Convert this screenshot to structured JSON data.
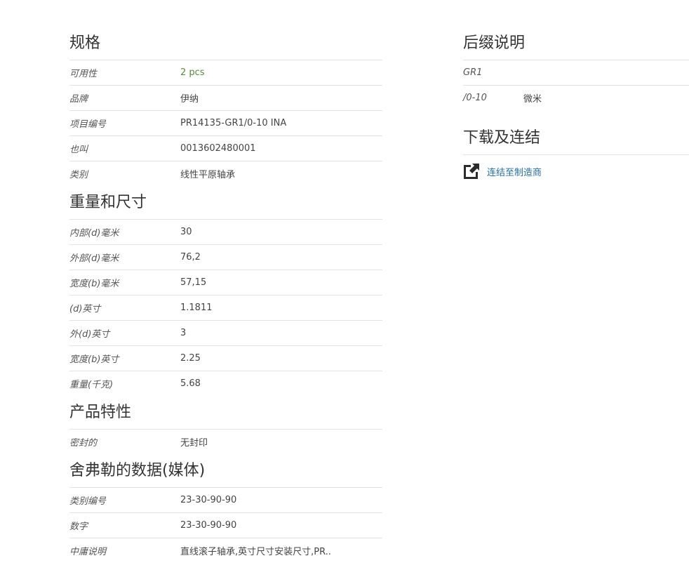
{
  "specs": {
    "title": "规格",
    "rows": [
      {
        "label": "可用性",
        "value": "2 pcs"
      },
      {
        "label": "品牌",
        "value": "伊纳"
      },
      {
        "label": "项目编号",
        "value": "PR14135-GR1/0-10 INA"
      },
      {
        "label": "也叫",
        "value": "0013602480001"
      },
      {
        "label": "类别",
        "value": "线性平原轴承"
      }
    ]
  },
  "dimensions": {
    "title": "重量和尺寸",
    "rows": [
      {
        "label": "内部(d)毫米",
        "value": "30"
      },
      {
        "label": "外部(d)毫米",
        "value": "76,2"
      },
      {
        "label": "宽度(b)毫米",
        "value": "57,15"
      },
      {
        "label": "(d)英寸",
        "value": "1.1811"
      },
      {
        "label": "外(d)英寸",
        "value": "3"
      },
      {
        "label": "宽度(b)英寸",
        "value": "2.25"
      },
      {
        "label": "重量(千克)",
        "value": "5.68"
      }
    ]
  },
  "features": {
    "title": "产品特性",
    "rows": [
      {
        "label": "密封的",
        "value": "无封印"
      }
    ]
  },
  "schaeffler": {
    "title": "舍弗勒的数据(媒体)",
    "rows": [
      {
        "label": "类别编号",
        "value": "23-30-90-90"
      },
      {
        "label": "数字",
        "value": "23-30-90-90"
      },
      {
        "label": "中庸说明",
        "value": "直线滚子轴承,英寸尺寸安装尺寸,PR.."
      }
    ]
  },
  "suffix": {
    "title": "后缀说明",
    "rows": [
      {
        "label": "GR1",
        "value": ""
      },
      {
        "label": "/0-10",
        "value": "微米"
      }
    ]
  },
  "downloads": {
    "title": "下载及连结",
    "link_label": "连结至制造商",
    "link_icon": "external-link-icon",
    "link_color": "#1f6fb5"
  },
  "colors": {
    "availability": "#5a8a3a",
    "divider": "#e2e2e2"
  }
}
